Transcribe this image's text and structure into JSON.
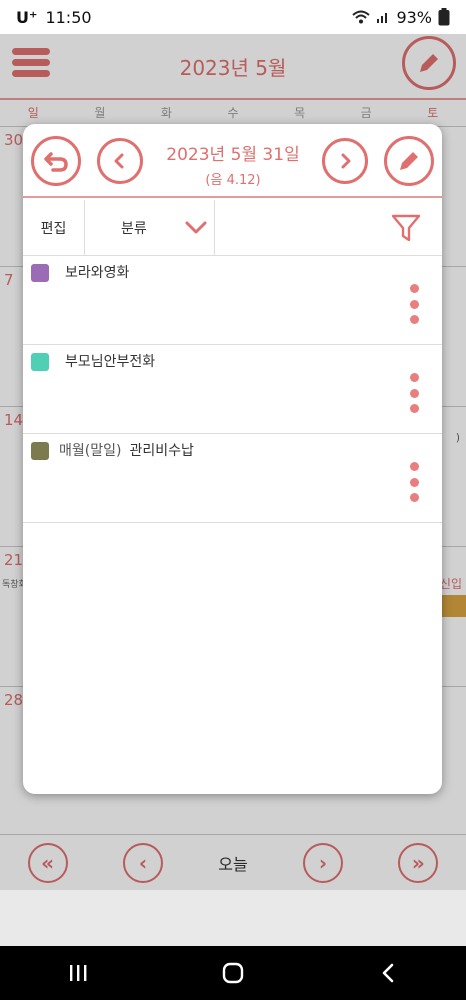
{
  "status_bar": {
    "carrier": "U⁺",
    "time": "11:50",
    "battery": "93%"
  },
  "calendar": {
    "month_title": "2023년 5월",
    "weekdays": [
      "일",
      "월",
      "화",
      "수",
      "목",
      "금",
      "토"
    ],
    "week_start_days": [
      "30",
      "7",
      "14",
      "21",
      "28"
    ],
    "right_text": "신입",
    "left_text": "독창회",
    "paren_text": ")"
  },
  "bottom_nav": {
    "today_label": "오늘",
    "first_label": "«",
    "prev_label": "‹",
    "next_label": "›",
    "last_label": "»"
  },
  "dialog": {
    "date": "2023년 5월 31일",
    "lunar_date": "(음 4.12)",
    "edit_label": "편집",
    "category_label": "분류",
    "events": [
      {
        "title": "보라와영화",
        "repeat": "",
        "color": "#9b6bb5"
      },
      {
        "title": "부모님안부전화",
        "repeat": "",
        "color": "#4fcfb3"
      },
      {
        "title": "관리비수납",
        "repeat": "매월(말일)",
        "color": "#7b7b4f"
      }
    ]
  },
  "colors": {
    "accent": "#e0706f"
  }
}
